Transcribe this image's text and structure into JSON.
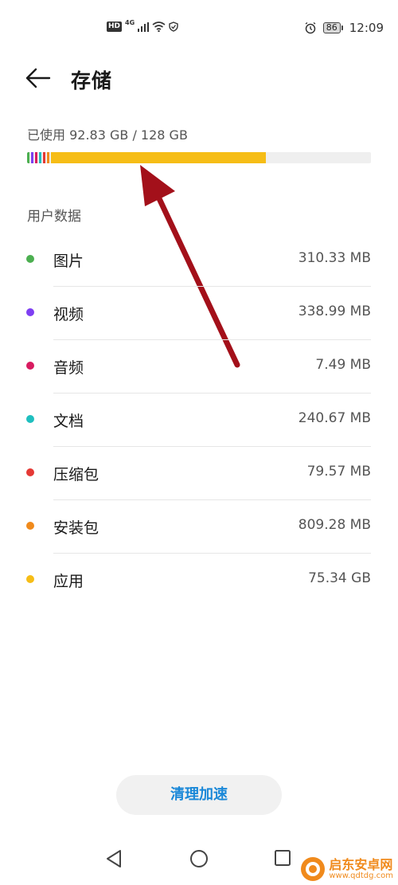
{
  "status_bar": {
    "hd": "HD",
    "network": "4G",
    "battery": "86",
    "time": "12:09",
    "icons": [
      "signal-icon",
      "wifi-icon",
      "shield-icon",
      "alarm-icon",
      "battery-icon"
    ]
  },
  "header": {
    "title": "存储"
  },
  "storage": {
    "used_text": "已使用 92.83 GB / 128 GB",
    "used_fraction": 0.725,
    "bar_segments": [
      {
        "color": "#4caf50",
        "fraction": 0.005
      },
      {
        "color": "#7e3ff2",
        "fraction": 0.005
      },
      {
        "color": "#d81b60",
        "fraction": 0.005
      },
      {
        "color": "#1fbfbf",
        "fraction": 0.005
      },
      {
        "color": "#e53935",
        "fraction": 0.005
      },
      {
        "color": "#f08a1c",
        "fraction": 0.006
      },
      {
        "color": "#f6bd16",
        "fraction": 0.625
      }
    ]
  },
  "user_data": {
    "title": "用户数据",
    "items": [
      {
        "name": "图片",
        "size": "310.33 MB",
        "color": "#4caf50"
      },
      {
        "name": "视频",
        "size": "338.99 MB",
        "color": "#7e3ff2"
      },
      {
        "name": "音频",
        "size": "7.49 MB",
        "color": "#d81b60"
      },
      {
        "name": "文档",
        "size": "240.67 MB",
        "color": "#1fbfbf"
      },
      {
        "name": "压缩包",
        "size": "79.57 MB",
        "color": "#e53935"
      },
      {
        "name": "安装包",
        "size": "809.28 MB",
        "color": "#f08a1c"
      },
      {
        "name": "应用",
        "size": "75.34 GB",
        "color": "#f6bd16"
      }
    ]
  },
  "actions": {
    "clean_label": "清理加速"
  },
  "navbar": {
    "icons": [
      "back-triangle-icon",
      "home-circle-icon",
      "recents-square-icon"
    ]
  },
  "watermark": {
    "name": "启东安卓网",
    "url": "www.qdtdg.com"
  }
}
